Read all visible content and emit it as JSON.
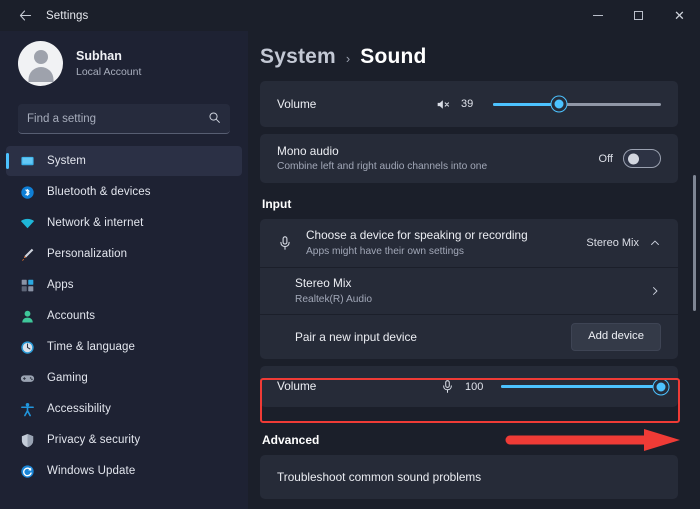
{
  "window": {
    "title": "Settings",
    "back_icon": "back-arrow-icon",
    "controls": {
      "minimize": "Minimize",
      "maximize": "Maximize",
      "close": "Close"
    }
  },
  "sidebar": {
    "account": {
      "name": "Subhan",
      "type": "Local Account",
      "avatar": "user-avatar"
    },
    "search": {
      "placeholder": "Find a setting",
      "icon": "search-icon"
    },
    "items": [
      {
        "label": "System",
        "icon": "system-icon",
        "active": true
      },
      {
        "label": "Bluetooth & devices",
        "icon": "bluetooth-icon",
        "active": false
      },
      {
        "label": "Network & internet",
        "icon": "network-icon",
        "active": false
      },
      {
        "label": "Personalization",
        "icon": "personalization-icon",
        "active": false
      },
      {
        "label": "Apps",
        "icon": "apps-icon",
        "active": false
      },
      {
        "label": "Accounts",
        "icon": "accounts-icon",
        "active": false
      },
      {
        "label": "Time & language",
        "icon": "time-language-icon",
        "active": false
      },
      {
        "label": "Gaming",
        "icon": "gaming-icon",
        "active": false
      },
      {
        "label": "Accessibility",
        "icon": "accessibility-icon",
        "active": false
      },
      {
        "label": "Privacy & security",
        "icon": "privacy-security-icon",
        "active": false
      },
      {
        "label": "Windows Update",
        "icon": "windows-update-icon",
        "active": false
      }
    ]
  },
  "main": {
    "breadcrumb": {
      "parent": "System",
      "separator": "›",
      "current": "Sound"
    },
    "output_volume": {
      "label": "Volume",
      "value": "39",
      "percent": 39,
      "icon": "speaker-mute-icon"
    },
    "mono_audio": {
      "title": "Mono audio",
      "subtitle": "Combine left and right audio channels into one",
      "state_label": "Off"
    },
    "input_section": {
      "heading": "Input",
      "choose_device": {
        "title": "Choose a device for speaking or recording",
        "subtitle": "Apps might have their own settings",
        "selected": "Stereo Mix",
        "icon": "microphone-icon",
        "chevron": "chevron-up-icon"
      },
      "device": {
        "name": "Stereo Mix",
        "driver": "Realtek(R) Audio",
        "chevron": "chevron-right-icon"
      },
      "pair_device": {
        "label": "Pair a new input device",
        "button": "Add device"
      },
      "input_volume": {
        "label": "Volume",
        "value": "100",
        "percent": 100,
        "icon": "microphone-icon"
      }
    },
    "advanced": {
      "heading": "Advanced",
      "troubleshoot": "Troubleshoot common sound problems"
    }
  },
  "annotations": {
    "highlight_color": "#ef3b36",
    "highlight_target": "input-volume-row",
    "arrow_direction": "right"
  },
  "colors": {
    "accent": "#4cc2ff",
    "sidebar_bg": "#1e2233",
    "content_bg": "#1b1f2a",
    "card_bg": "#262b38",
    "annotation": "#ef3b36"
  }
}
